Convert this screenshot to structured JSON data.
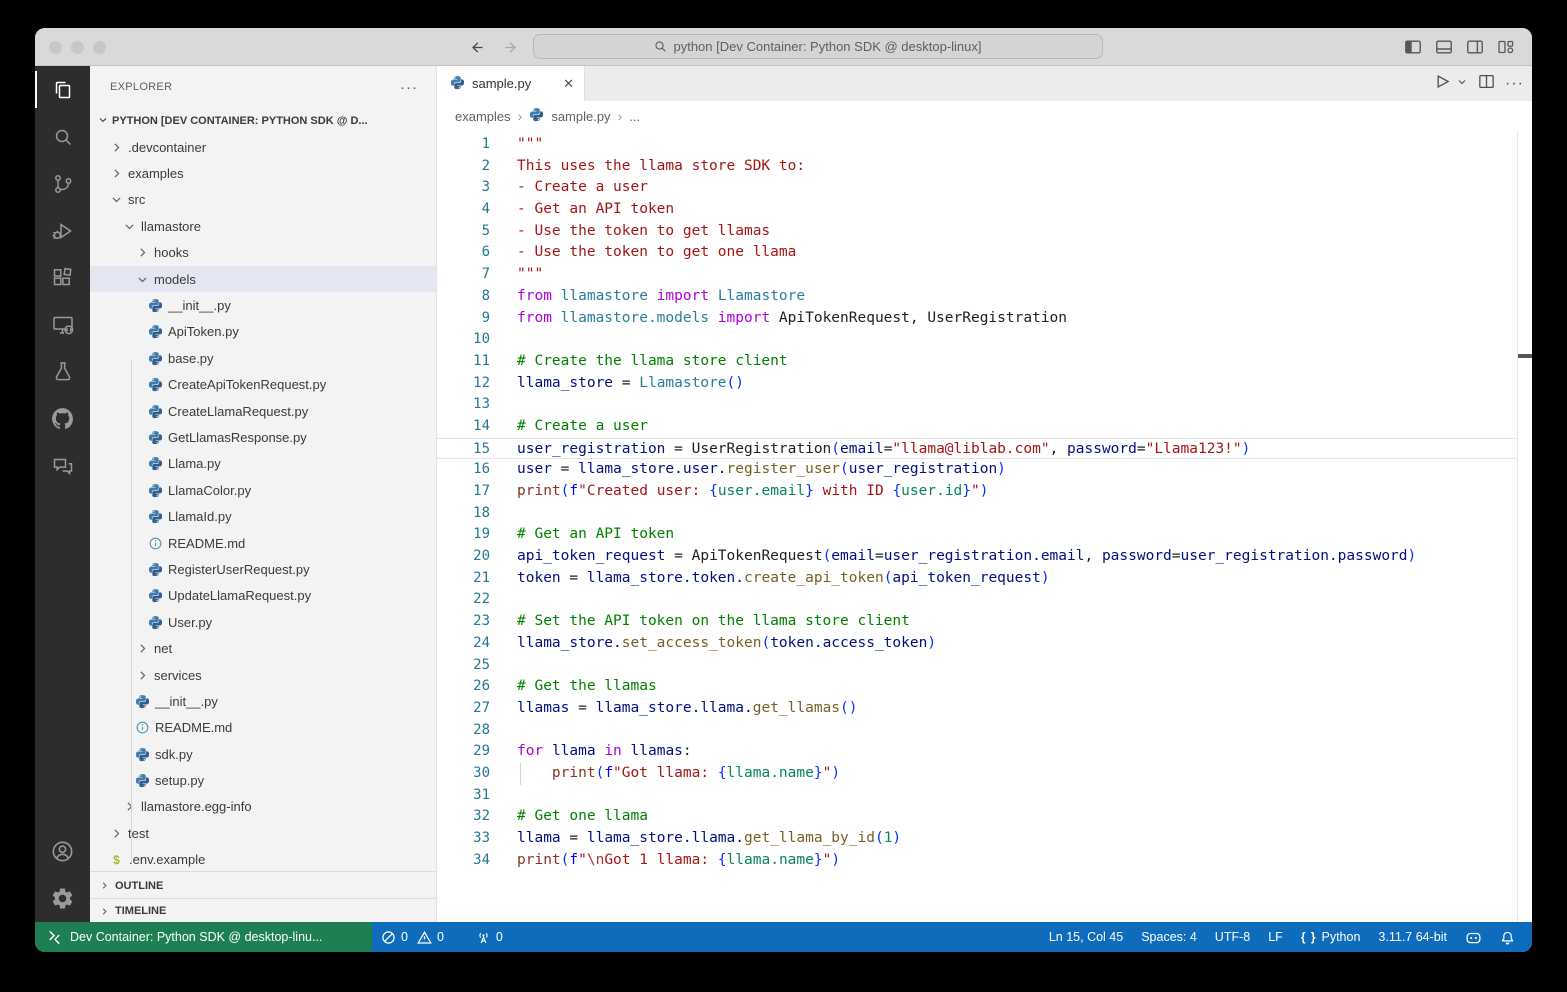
{
  "window": {
    "titlebar": {
      "search_text": "python [Dev Container: Python SDK @ desktop-linux]",
      "back_icon": "arrow-left",
      "forward_icon": "arrow-right",
      "layout_icons": [
        "layout-sidebar-left",
        "layout-panel",
        "layout-sidebar-right",
        "layout-customize"
      ]
    }
  },
  "activity_bar": {
    "top": [
      {
        "name": "explorer",
        "active": true
      },
      {
        "name": "search",
        "active": false
      },
      {
        "name": "source-control",
        "active": false
      },
      {
        "name": "run-and-debug",
        "active": false
      },
      {
        "name": "extensions",
        "active": false
      },
      {
        "name": "remote-explorer",
        "active": false
      },
      {
        "name": "testing",
        "active": false
      },
      {
        "name": "github",
        "active": false
      },
      {
        "name": "comments",
        "active": false
      }
    ],
    "bottom": [
      {
        "name": "accounts",
        "active": false
      },
      {
        "name": "manage",
        "active": false
      }
    ]
  },
  "sidebar": {
    "title": "EXPLORER",
    "actions_label": "···",
    "section_label": "PYTHON [DEV CONTAINER: PYTHON SDK @ D...",
    "outline_label": "OUTLINE",
    "timeline_label": "TIMELINE",
    "tree": [
      {
        "label": ".devcontainer",
        "kind": "folder",
        "state": "collapsed",
        "indent": 1
      },
      {
        "label": "examples",
        "kind": "folder",
        "state": "collapsed",
        "indent": 1
      },
      {
        "label": "src",
        "kind": "folder",
        "state": "expanded",
        "indent": 1
      },
      {
        "label": "llamastore",
        "kind": "folder",
        "state": "expanded",
        "indent": 2
      },
      {
        "label": "hooks",
        "kind": "folder",
        "state": "collapsed",
        "indent": 3
      },
      {
        "label": "models",
        "kind": "folder",
        "state": "expanded",
        "indent": 3,
        "selected": true
      },
      {
        "label": "__init__.py",
        "kind": "file",
        "icon": "python",
        "indent": 4
      },
      {
        "label": "ApiToken.py",
        "kind": "file",
        "icon": "python",
        "indent": 4
      },
      {
        "label": "base.py",
        "kind": "file",
        "icon": "python",
        "indent": 4
      },
      {
        "label": "CreateApiTokenRequest.py",
        "kind": "file",
        "icon": "python",
        "indent": 4
      },
      {
        "label": "CreateLlamaRequest.py",
        "kind": "file",
        "icon": "python",
        "indent": 4
      },
      {
        "label": "GetLlamasResponse.py",
        "kind": "file",
        "icon": "python",
        "indent": 4
      },
      {
        "label": "Llama.py",
        "kind": "file",
        "icon": "python",
        "indent": 4
      },
      {
        "label": "LlamaColor.py",
        "kind": "file",
        "icon": "python",
        "indent": 4
      },
      {
        "label": "LlamaId.py",
        "kind": "file",
        "icon": "python",
        "indent": 4
      },
      {
        "label": "README.md",
        "kind": "file",
        "icon": "info",
        "indent": 4
      },
      {
        "label": "RegisterUserRequest.py",
        "kind": "file",
        "icon": "python",
        "indent": 4
      },
      {
        "label": "UpdateLlamaRequest.py",
        "kind": "file",
        "icon": "python",
        "indent": 4
      },
      {
        "label": "User.py",
        "kind": "file",
        "icon": "python",
        "indent": 4
      },
      {
        "label": "net",
        "kind": "folder",
        "state": "collapsed",
        "indent": 3
      },
      {
        "label": "services",
        "kind": "folder",
        "state": "collapsed",
        "indent": 3
      },
      {
        "label": "__init__.py",
        "kind": "file",
        "icon": "python",
        "indent": 3
      },
      {
        "label": "README.md",
        "kind": "file",
        "icon": "info",
        "indent": 3
      },
      {
        "label": "sdk.py",
        "kind": "file",
        "icon": "python",
        "indent": 3
      },
      {
        "label": "setup.py",
        "kind": "file",
        "icon": "python",
        "indent": 3
      },
      {
        "label": "llamastore.egg-info",
        "kind": "folder",
        "state": "collapsed",
        "indent": 2
      },
      {
        "label": "test",
        "kind": "folder",
        "state": "collapsed",
        "indent": 1
      },
      {
        "label": ".env.example",
        "kind": "file",
        "icon": "dollar",
        "indent": 1
      }
    ]
  },
  "editor": {
    "tab": {
      "icon": "python",
      "label": "sample.py",
      "close_label": "✕"
    },
    "actions": [
      "run",
      "run-dropdown",
      "split-editor",
      "more-actions"
    ],
    "breadcrumbs": [
      "examples",
      "sample.py",
      "..."
    ],
    "code": {
      "current_line": 15,
      "colors": {
        "kw": "#af00db",
        "type": "#267f99",
        "var": "#001080",
        "fn": "#795e26",
        "print": "#8b3226",
        "str": "#a31515",
        "esc": "#c03030",
        "interp": "#098658",
        "num": "#098658",
        "brk": "#0431fa",
        "fstr": "#0000ff",
        "plain": "#1f1f1f",
        "comment": "#008000"
      },
      "lines": [
        {
          "n": 1,
          "t": [
            [
              "\"\"\"",
              "str"
            ]
          ]
        },
        {
          "n": 2,
          "t": [
            [
              "This uses the llama store SDK to:",
              "str"
            ]
          ]
        },
        {
          "n": 3,
          "t": [
            [
              "- Create a user",
              "str"
            ]
          ]
        },
        {
          "n": 4,
          "t": [
            [
              "- Get an API token",
              "str"
            ]
          ]
        },
        {
          "n": 5,
          "t": [
            [
              "- Use the token to get llamas",
              "str"
            ]
          ]
        },
        {
          "n": 6,
          "t": [
            [
              "- Use the token to get one llama",
              "str"
            ]
          ]
        },
        {
          "n": 7,
          "t": [
            [
              "\"\"\"",
              "str"
            ]
          ]
        },
        {
          "n": 8,
          "t": [
            [
              "from",
              "kw"
            ],
            [
              " ",
              "plain"
            ],
            [
              "llamastore",
              "type"
            ],
            [
              " ",
              "plain"
            ],
            [
              "import",
              "kw"
            ],
            [
              " ",
              "plain"
            ],
            [
              "Llamastore",
              "type"
            ]
          ]
        },
        {
          "n": 9,
          "t": [
            [
              "from",
              "kw"
            ],
            [
              " ",
              "plain"
            ],
            [
              "llamastore.models",
              "type"
            ],
            [
              " ",
              "plain"
            ],
            [
              "import",
              "kw"
            ],
            [
              " ",
              "plain"
            ],
            [
              "ApiTokenRequest, UserRegistration",
              "plain"
            ]
          ]
        },
        {
          "n": 10,
          "t": []
        },
        {
          "n": 11,
          "t": [
            [
              "# Create the llama store client",
              "comment"
            ]
          ]
        },
        {
          "n": 12,
          "t": [
            [
              "llama_store",
              "var"
            ],
            [
              " = ",
              "plain"
            ],
            [
              "Llamastore",
              "type"
            ],
            [
              "()",
              "brk"
            ]
          ]
        },
        {
          "n": 13,
          "t": []
        },
        {
          "n": 14,
          "t": [
            [
              "# Create a user",
              "comment"
            ]
          ]
        },
        {
          "n": 15,
          "t": [
            [
              "user_registration",
              "var"
            ],
            [
              " = ",
              "plain"
            ],
            [
              "UserRegistration",
              "plain"
            ],
            [
              "(",
              "brk"
            ],
            [
              "email",
              "var"
            ],
            [
              "=",
              "plain"
            ],
            [
              "\"llama@liblab.com\"",
              "str"
            ],
            [
              ", ",
              "plain"
            ],
            [
              "password",
              "var"
            ],
            [
              "=",
              "plain"
            ],
            [
              "\"Llama123!\"",
              "str"
            ],
            [
              ")",
              "brk"
            ]
          ]
        },
        {
          "n": 16,
          "t": [
            [
              "user",
              "var"
            ],
            [
              " = ",
              "plain"
            ],
            [
              "llama_store.user.",
              "var"
            ],
            [
              "register_user",
              "fn"
            ],
            [
              "(",
              "brk"
            ],
            [
              "user_registration",
              "var"
            ],
            [
              ")",
              "brk"
            ]
          ]
        },
        {
          "n": 17,
          "t": [
            [
              "print",
              "print"
            ],
            [
              "(",
              "brk"
            ],
            [
              "f",
              "fstr"
            ],
            [
              "\"Created user: ",
              "str"
            ],
            [
              "{",
              "brk"
            ],
            [
              "user.email",
              "interp"
            ],
            [
              "}",
              "brk"
            ],
            [
              " with ID ",
              "str"
            ],
            [
              "{",
              "brk"
            ],
            [
              "user.id",
              "interp"
            ],
            [
              "}",
              "brk"
            ],
            [
              "\"",
              "str"
            ],
            [
              ")",
              "brk"
            ]
          ]
        },
        {
          "n": 18,
          "t": []
        },
        {
          "n": 19,
          "t": [
            [
              "# Get an API token",
              "comment"
            ]
          ]
        },
        {
          "n": 20,
          "t": [
            [
              "api_token_request",
              "var"
            ],
            [
              " = ",
              "plain"
            ],
            [
              "ApiTokenRequest",
              "plain"
            ],
            [
              "(",
              "brk"
            ],
            [
              "email",
              "var"
            ],
            [
              "=",
              "plain"
            ],
            [
              "user_registration.email",
              "var"
            ],
            [
              ", ",
              "plain"
            ],
            [
              "password",
              "var"
            ],
            [
              "=",
              "plain"
            ],
            [
              "user_registration.password",
              "var"
            ],
            [
              ")",
              "brk"
            ]
          ]
        },
        {
          "n": 21,
          "t": [
            [
              "token",
              "var"
            ],
            [
              " = ",
              "plain"
            ],
            [
              "llama_store.token.",
              "var"
            ],
            [
              "create_api_token",
              "fn"
            ],
            [
              "(",
              "brk"
            ],
            [
              "api_token_request",
              "var"
            ],
            [
              ")",
              "brk"
            ]
          ]
        },
        {
          "n": 22,
          "t": []
        },
        {
          "n": 23,
          "t": [
            [
              "# Set the API token on the llama store client",
              "comment"
            ]
          ]
        },
        {
          "n": 24,
          "t": [
            [
              "llama_store.",
              "var"
            ],
            [
              "set_access_token",
              "fn"
            ],
            [
              "(",
              "brk"
            ],
            [
              "token.access_token",
              "var"
            ],
            [
              ")",
              "brk"
            ]
          ]
        },
        {
          "n": 25,
          "t": []
        },
        {
          "n": 26,
          "t": [
            [
              "# Get the llamas",
              "comment"
            ]
          ]
        },
        {
          "n": 27,
          "t": [
            [
              "llamas",
              "var"
            ],
            [
              " = ",
              "plain"
            ],
            [
              "llama_store.llama.",
              "var"
            ],
            [
              "get_llamas",
              "fn"
            ],
            [
              "()",
              "brk"
            ]
          ]
        },
        {
          "n": 28,
          "t": []
        },
        {
          "n": 29,
          "t": [
            [
              "for",
              "kw"
            ],
            [
              " ",
              "plain"
            ],
            [
              "llama",
              "var"
            ],
            [
              " ",
              "plain"
            ],
            [
              "in",
              "kw"
            ],
            [
              " ",
              "plain"
            ],
            [
              "llamas",
              "var"
            ],
            [
              ":",
              "plain"
            ]
          ]
        },
        {
          "n": 30,
          "t": [
            [
              "    ",
              "plain"
            ],
            [
              "print",
              "print"
            ],
            [
              "(",
              "brk"
            ],
            [
              "f",
              "fstr"
            ],
            [
              "\"Got llama: ",
              "str"
            ],
            [
              "{",
              "brk"
            ],
            [
              "llama.name",
              "interp"
            ],
            [
              "}",
              "brk"
            ],
            [
              "\"",
              "str"
            ],
            [
              ")",
              "brk"
            ]
          ],
          "guide": true
        },
        {
          "n": 31,
          "t": []
        },
        {
          "n": 32,
          "t": [
            [
              "# Get one llama",
              "comment"
            ]
          ]
        },
        {
          "n": 33,
          "t": [
            [
              "llama",
              "var"
            ],
            [
              " = ",
              "plain"
            ],
            [
              "llama_store.llama.",
              "var"
            ],
            [
              "get_llama_by_id",
              "fn"
            ],
            [
              "(",
              "brk"
            ],
            [
              "1",
              "num"
            ],
            [
              ")",
              "brk"
            ]
          ]
        },
        {
          "n": 34,
          "t": [
            [
              "print",
              "print"
            ],
            [
              "(",
              "brk"
            ],
            [
              "f",
              "fstr"
            ],
            [
              "\"",
              "str"
            ],
            [
              "\\n",
              "esc"
            ],
            [
              "Got 1 llama: ",
              "str"
            ],
            [
              "{",
              "brk"
            ],
            [
              "llama.name",
              "interp"
            ],
            [
              "}",
              "brk"
            ],
            [
              "\"",
              "str"
            ],
            [
              ")",
              "brk"
            ]
          ]
        }
      ]
    }
  },
  "status_bar": {
    "remote_label": "Dev Container: Python SDK @ desktop-linu...",
    "errors": "0",
    "warnings": "0",
    "ports": "0",
    "cursor_position": "Ln 15, Col 45",
    "indentation": "Spaces: 4",
    "encoding": "UTF-8",
    "eol": "LF",
    "language_icon": "{ }",
    "language": "Python",
    "interpreter": "3.11.7 64-bit"
  },
  "theme": {
    "statusbar_blue": "#0f6cbd",
    "remote_green": "#1d7f52",
    "selection_bg": "#e4e6f1",
    "line_number": "#237893",
    "activitybar_bg": "#2d2d2d"
  }
}
